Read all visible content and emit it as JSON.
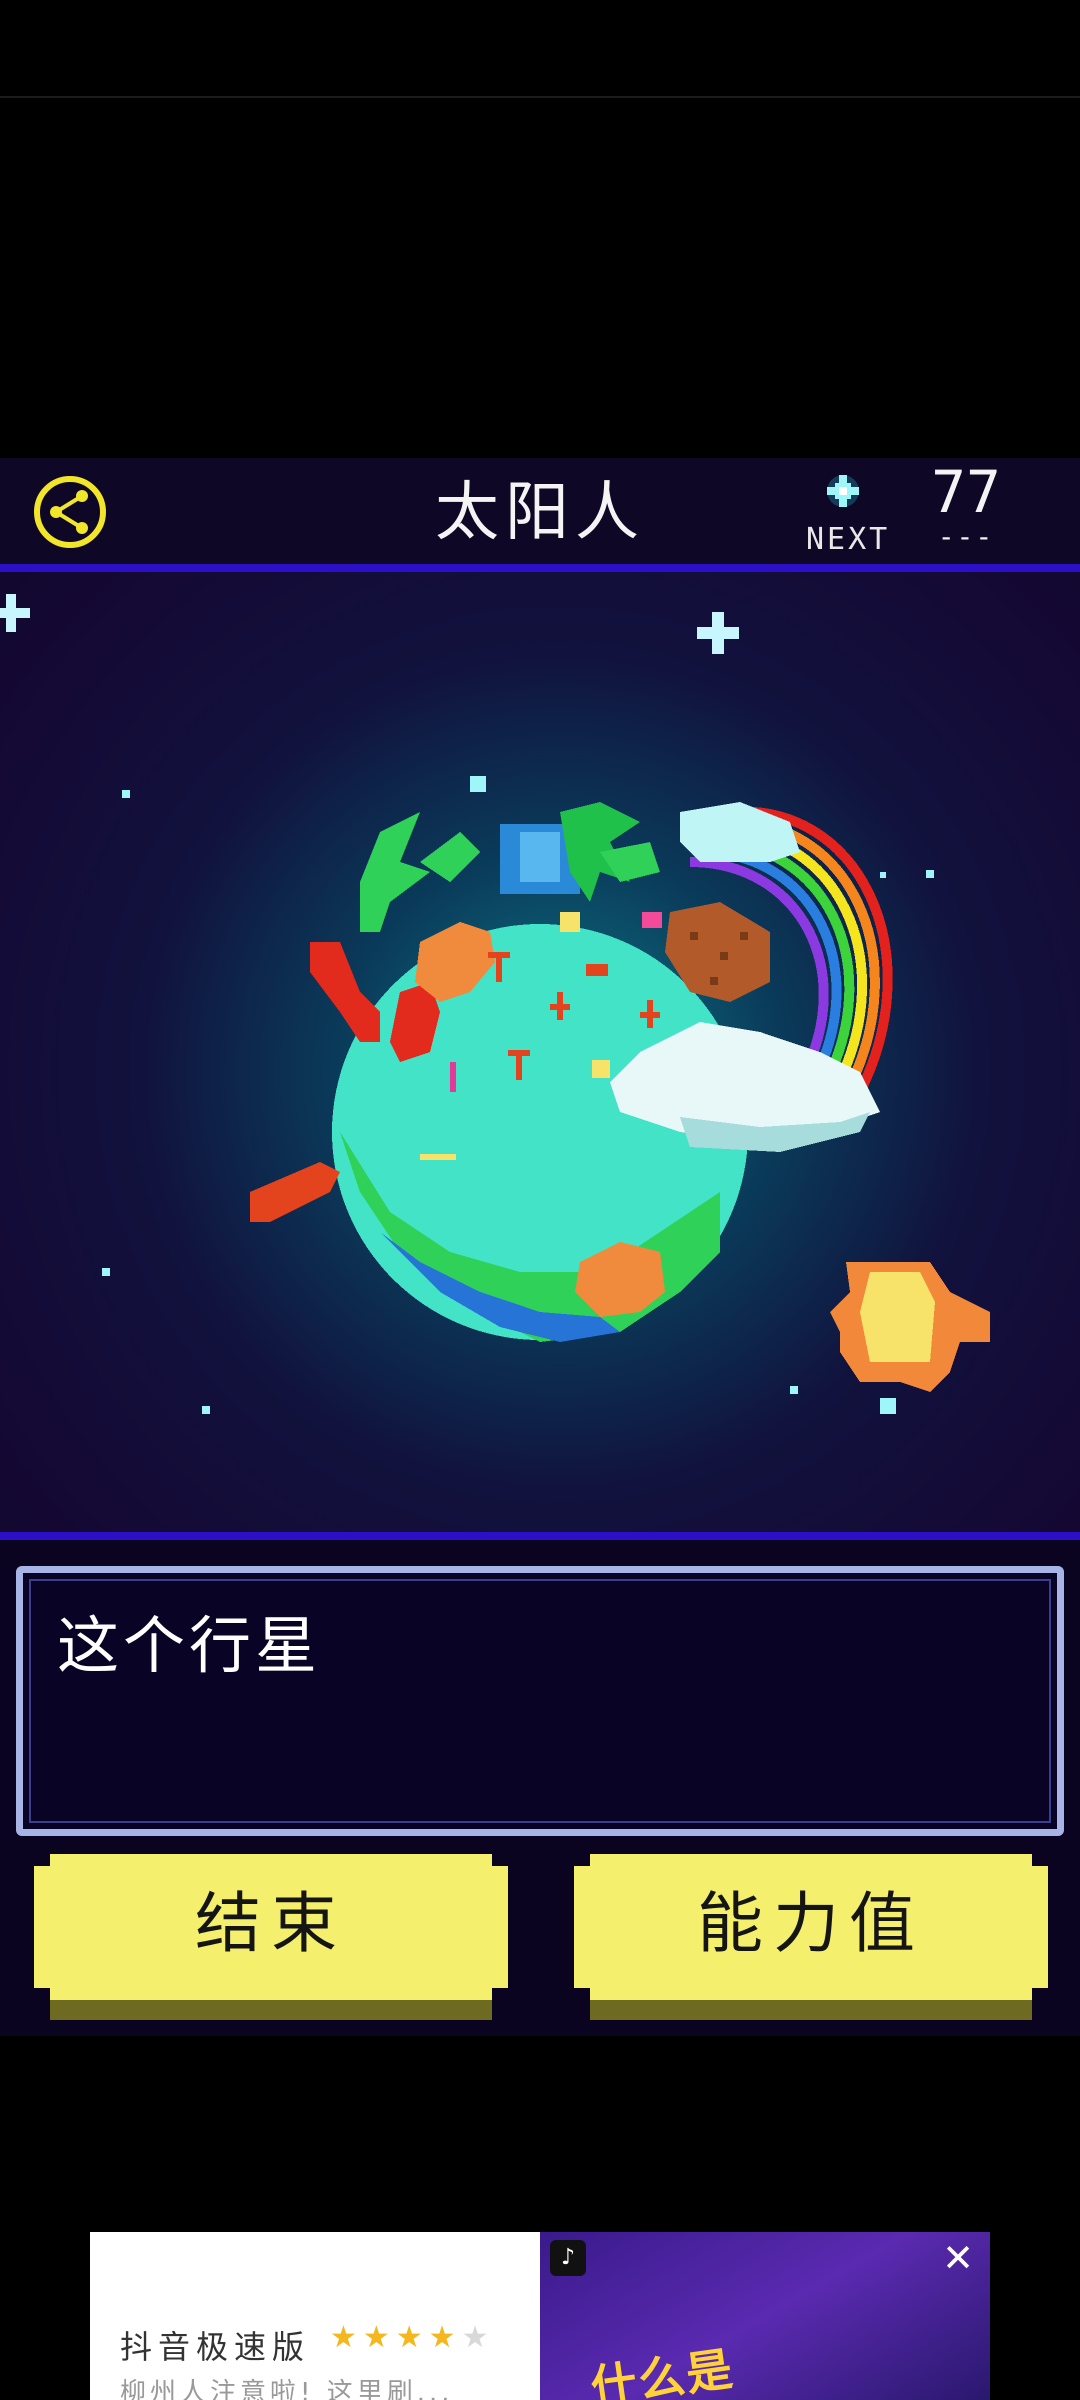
{
  "header": {
    "title": "太阳人",
    "next_label": "NEXT",
    "next_count": "77",
    "next_dash": "---",
    "share_icon": "share-icon",
    "next_icon": "sparkle-icon"
  },
  "scene": {
    "planet": "pixel-planet",
    "rocket": "pixel-rocket",
    "rainbow": "rainbow"
  },
  "message": {
    "text": "这个行星"
  },
  "buttons": {
    "end_label": "结束",
    "stats_label": "能力值"
  },
  "ad": {
    "title": "抖音极速版",
    "rating": 4,
    "subtitle": "柳州人注意啦! 这里刷...",
    "headline": "什么是",
    "close_icon": "close-icon",
    "brand_icon": "tiktok-icon"
  },
  "colors": {
    "accent_bar": "#2c10c8",
    "button_face": "#f4ef6c",
    "message_border": "#a8b4e6"
  }
}
